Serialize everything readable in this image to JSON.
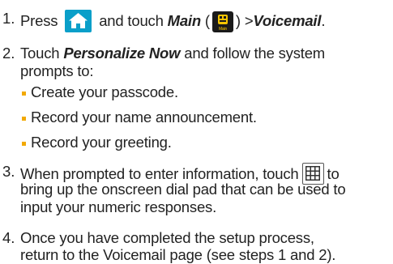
{
  "steps": [
    {
      "number": "1.",
      "text_press": "Press",
      "text_and_touch": "and touch",
      "main_label": "Main",
      "paren_open": "(",
      "paren_close": ")",
      "arrow": ">",
      "voicemail_label": "Voicemail",
      "period": "."
    },
    {
      "number": "2.",
      "touch": "Touch",
      "personalize_now": "Personalize Now",
      "rest_line1": "and follow the system",
      "line2": "prompts to:",
      "bullets": [
        "Create your passcode.",
        "Record your name announcement.",
        "Record your greeting."
      ]
    },
    {
      "number": "3.",
      "line1_a": "When prompted to enter information, touch",
      "line1_b": "to",
      "line2": "bring up the onscreen dial pad that can be used to",
      "line3": "input your numeric responses."
    },
    {
      "number": "4.",
      "line1": "Once you have completed the setup process,",
      "line2": "return to the Voicemail page (see steps 1 and 2)."
    }
  ],
  "icons": {
    "home": "home-icon",
    "main": "main-app-icon",
    "main_icon_caption": "Main",
    "dialpad": "dialpad-icon"
  },
  "colors": {
    "text": "#222222",
    "bullet": "#f2a900",
    "home_icon_bg": "#0a9fc9",
    "main_icon_bg": "#1a1a1a",
    "main_icon_glyph": "#f5c400"
  }
}
